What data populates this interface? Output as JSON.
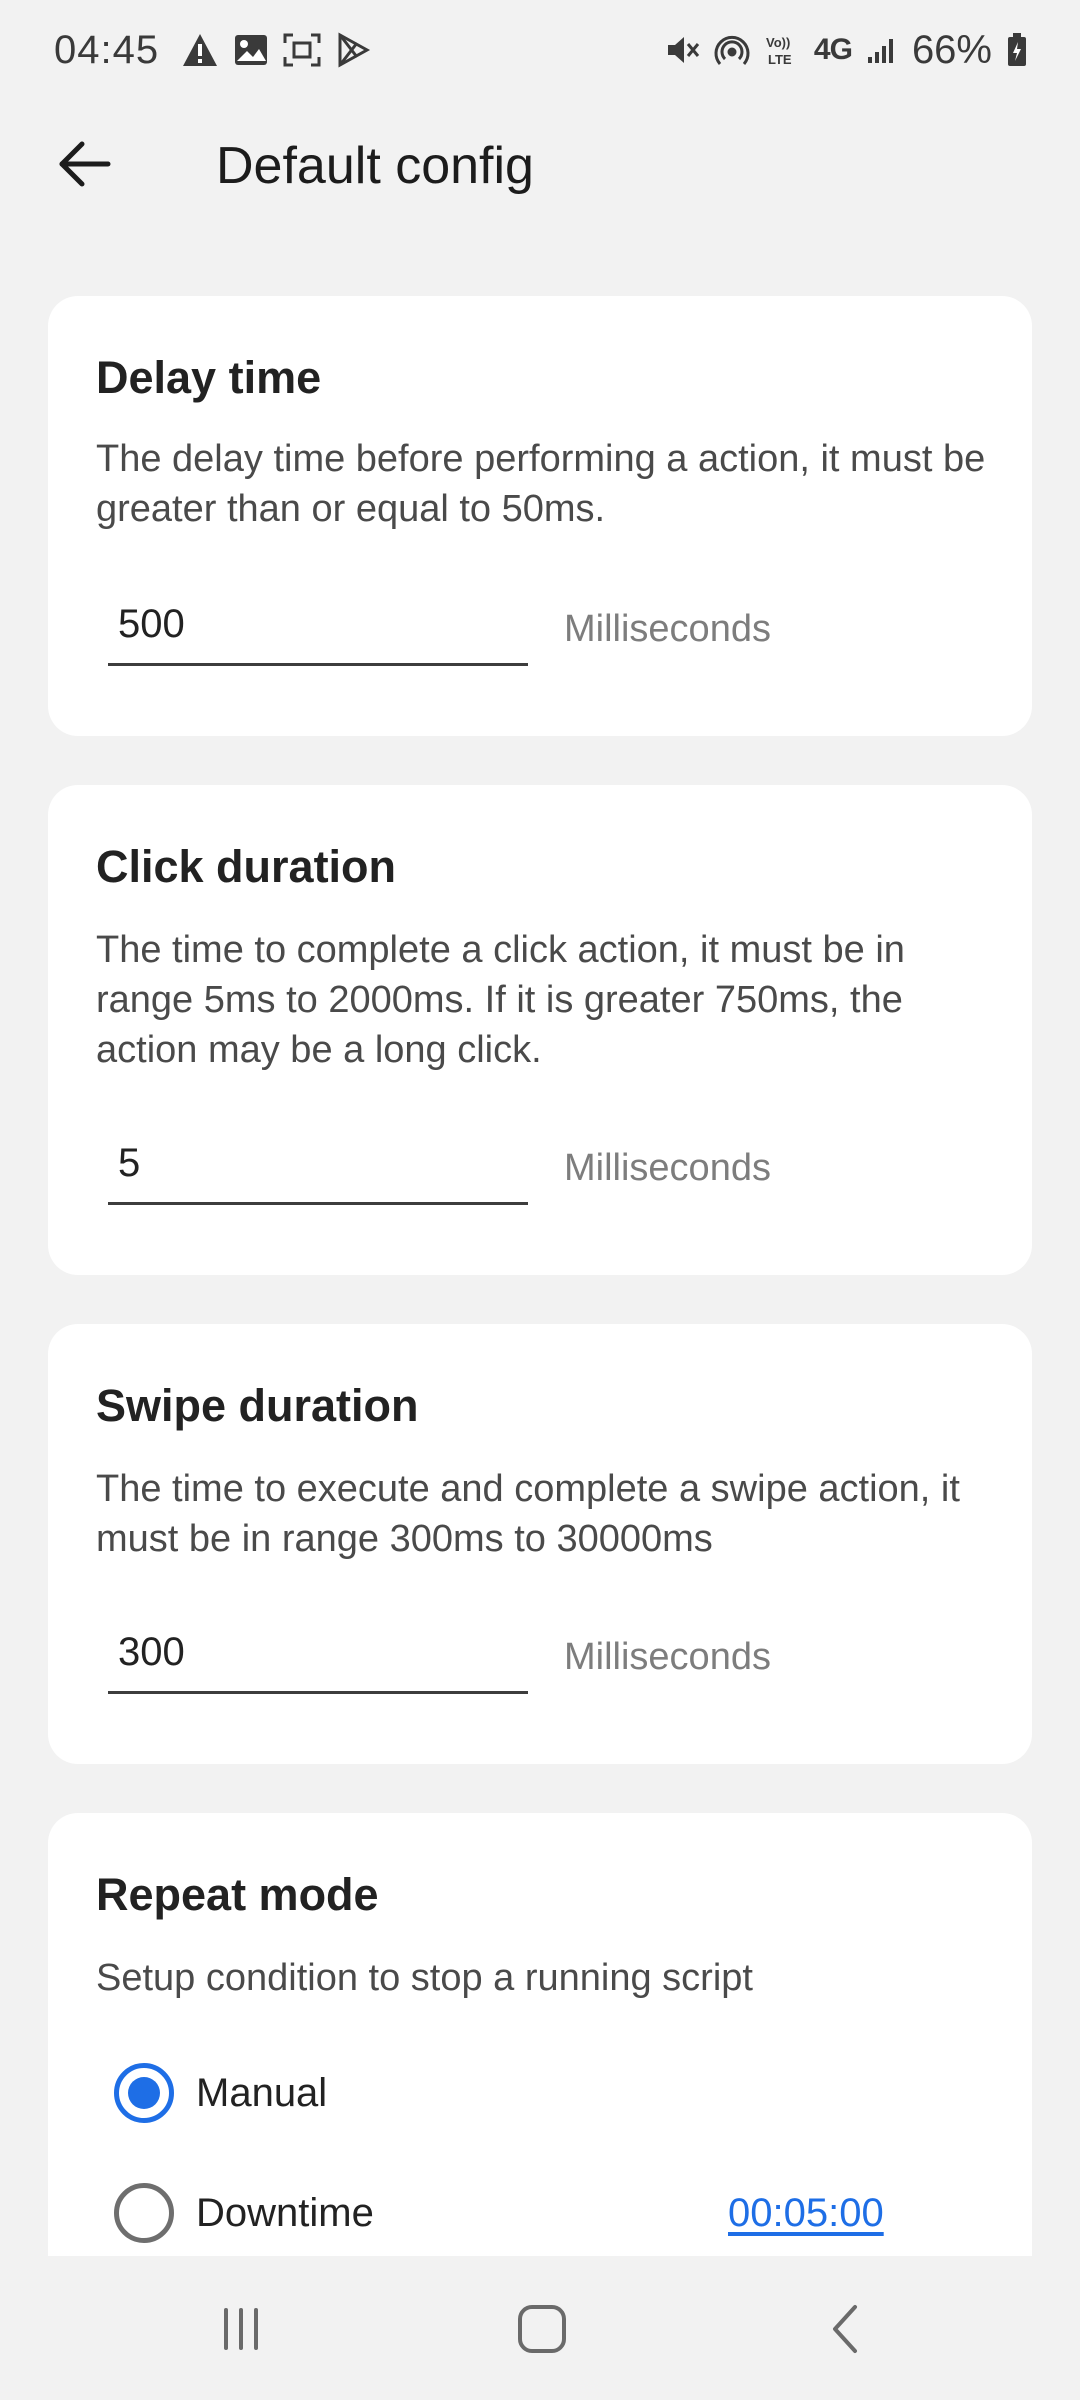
{
  "status_bar": {
    "time": "04:45",
    "network": "4G",
    "battery": "66%",
    "icons": [
      "alert-icon",
      "image-icon",
      "screenshot-icon",
      "play-store-icon",
      "mute-icon",
      "hotspot-icon",
      "volte-icon",
      "signal-icon",
      "battery-icon"
    ]
  },
  "app_bar": {
    "title": "Default config",
    "back_icon": "arrow-left-icon"
  },
  "cards": {
    "delay": {
      "title": "Delay time",
      "description": "The delay time before performing a action, it must be greater than or equal to 50ms.",
      "value": "500",
      "unit": "Milliseconds"
    },
    "click": {
      "title": "Click duration",
      "description": "The time to complete a click action, it must be in range 5ms to 2000ms. If it is greater 750ms, the action may be a long click.",
      "value": "5",
      "unit": "Milliseconds"
    },
    "swipe": {
      "title": "Swipe duration",
      "description": "The time to execute and complete a swipe action, it must be in range 300ms to 30000ms",
      "value": "300",
      "unit": "Milliseconds"
    },
    "repeat": {
      "title": "Repeat mode",
      "description": "Setup condition to stop a running script",
      "options": [
        {
          "label": "Manual",
          "selected": true
        },
        {
          "label": "Downtime",
          "selected": false,
          "value": "00:05:00"
        }
      ]
    }
  },
  "nav_bar": {
    "icons": [
      "recents-icon",
      "home-icon",
      "back-icon"
    ]
  },
  "colors": {
    "accent": "#1e6ee6",
    "background": "#f2f2f2",
    "card": "#ffffff"
  }
}
